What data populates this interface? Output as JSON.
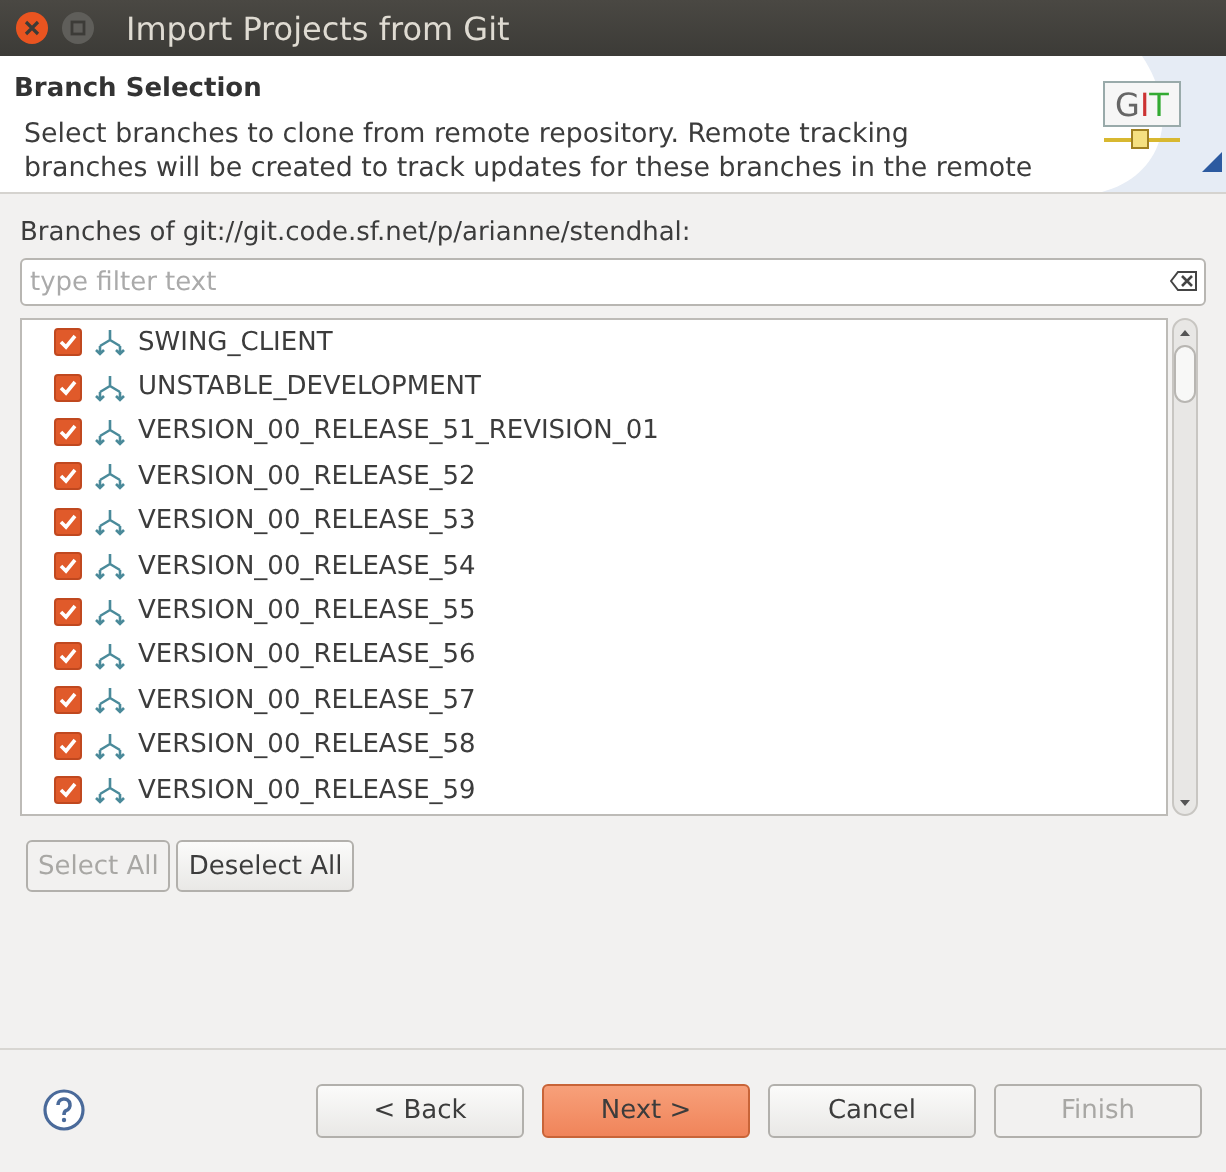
{
  "window": {
    "title": "Import Projects from Git"
  },
  "header": {
    "title": "Branch Selection",
    "description_lines": [
      "Select branches to clone from remote repository. Remote tracking",
      "branches will be created to track updates for these branches in the remote"
    ]
  },
  "logo_letters": [
    "G",
    "I",
    "T"
  ],
  "branches_label": "Branches of git://git.code.sf.net/p/arianne/stendhal:",
  "filter": {
    "placeholder": "type filter text"
  },
  "branches": [
    {
      "name": "SWING_CLIENT",
      "checked": true
    },
    {
      "name": "UNSTABLE_DEVELOPMENT",
      "checked": true
    },
    {
      "name": "VERSION_00_RELEASE_51_REVISION_01",
      "checked": true
    },
    {
      "name": "VERSION_00_RELEASE_52",
      "checked": true
    },
    {
      "name": "VERSION_00_RELEASE_53",
      "checked": true
    },
    {
      "name": "VERSION_00_RELEASE_54",
      "checked": true
    },
    {
      "name": "VERSION_00_RELEASE_55",
      "checked": true
    },
    {
      "name": "VERSION_00_RELEASE_56",
      "checked": true
    },
    {
      "name": "VERSION_00_RELEASE_57",
      "checked": true
    },
    {
      "name": "VERSION_00_RELEASE_58",
      "checked": true
    },
    {
      "name": "VERSION_00_RELEASE_59",
      "checked": true
    }
  ],
  "selection_buttons": [
    {
      "label": "Select All",
      "disabled": true
    },
    {
      "label": "Deselect All",
      "disabled": false
    }
  ],
  "footer_buttons": [
    {
      "label": "< Back",
      "disabled": false,
      "default": false
    },
    {
      "label": "Next >",
      "disabled": false,
      "default": true
    },
    {
      "label": "Cancel",
      "disabled": false,
      "default": false
    },
    {
      "label": "Finish",
      "disabled": true,
      "default": false
    }
  ]
}
